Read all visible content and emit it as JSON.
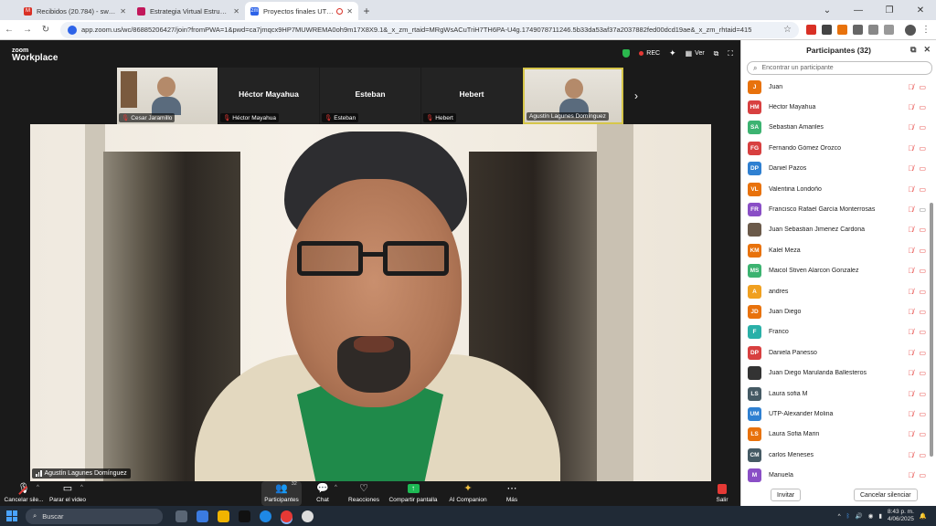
{
  "browser": {
    "tabs": [
      {
        "label": "Recibidos (20.784) - swokosky@",
        "favicon_color": "#d93025",
        "favicon_letter": "M",
        "active": false
      },
      {
        "label": "Estrategia Virtual Estructura de",
        "favicon_color": "#c2185b",
        "favicon_letter": "",
        "active": false
      },
      {
        "label": "Proyectos finales UTP-UV",
        "favicon_color": "#2d63e8",
        "favicon_letter": "zm",
        "active": true
      }
    ],
    "new_tab": "+",
    "url": "app.zoom.us/wc/86885206427/join?fromPWA=1&pwd=ca7jmqcx9HP7MUWREMA0oh9m17X8X9.1&_x_zm_rtaid=MRgWsACuTriH7TH6PA-U4g.1749078711246.5b33da53af37a2037882fed00dcd19ae&_x_zm_rhtaid=415"
  },
  "zoom": {
    "logo_top": "zoom",
    "logo_bottom": "Workplace",
    "rec_label": "REC",
    "view_label": "Ver",
    "gallery": [
      {
        "name": "Cesar Jaramillo",
        "has_video": true,
        "big": ""
      },
      {
        "name": "Héctor Mayahua",
        "has_video": false,
        "big": "Héctor Mayahua"
      },
      {
        "name": "Esteban",
        "has_video": false,
        "big": "Esteban"
      },
      {
        "name": "Hebert",
        "has_video": false,
        "big": "Hebert"
      },
      {
        "name": "Agustín Lagunes Domínguez",
        "has_video": true,
        "big": ""
      }
    ],
    "active_speaker": "Agustín Lagunes Domínguez",
    "toolbar": {
      "mic": "Cancelar sile...",
      "video": "Parar el video",
      "participants": "Participantes",
      "participants_count": "32",
      "chat": "Chat",
      "reactions": "Reacciones",
      "share": "Compartir pantalla",
      "companion": "AI Companion",
      "more": "Más",
      "leave": "Salir"
    }
  },
  "panel": {
    "title": "Participantes (32)",
    "search_placeholder": "Encontrar un participante",
    "invite": "Invitar",
    "mute_all": "Cancelar silenciar",
    "participants": [
      {
        "initials": "J",
        "name": "Juan",
        "color": "#e8720c",
        "video": false
      },
      {
        "initials": "HM",
        "name": "Héctor Mayahua",
        "color": "#d84040",
        "video": false
      },
      {
        "initials": "SA",
        "name": "Sebastian Amariles",
        "color": "#3cb371",
        "video": false
      },
      {
        "initials": "FG",
        "name": "Fernando Gómez Orozco",
        "color": "#d84040",
        "video": false
      },
      {
        "initials": "DP",
        "name": "Daniel Pazos",
        "color": "#2f80d1",
        "video": false
      },
      {
        "initials": "VL",
        "name": "Valentina Londoño",
        "color": "#e8720c",
        "video": false
      },
      {
        "initials": "FR",
        "name": "Francisco Rafael García Monterrosas",
        "color": "#8a4fc6",
        "video": true
      },
      {
        "initials": "",
        "name": "Juan Sebastian Jimenez Cardona",
        "color": "#6b5a4a",
        "video": false
      },
      {
        "initials": "KM",
        "name": "Kalel Meza",
        "color": "#e8720c",
        "video": false
      },
      {
        "initials": "MS",
        "name": "Maicol Stiven Alarcon Gonzalez",
        "color": "#3cb371",
        "video": false
      },
      {
        "initials": "A",
        "name": "andres",
        "color": "#f0a020",
        "video": false
      },
      {
        "initials": "JD",
        "name": "Juan Diego",
        "color": "#e8720c",
        "video": false
      },
      {
        "initials": "F",
        "name": "Franco",
        "color": "#2ab0a8",
        "video": false
      },
      {
        "initials": "DP",
        "name": "Daniela Panesso",
        "color": "#d84040",
        "video": false
      },
      {
        "initials": "",
        "name": "Juan Diego Marulanda Ballesteros",
        "color": "#333333",
        "video": false
      },
      {
        "initials": "LS",
        "name": "Laura sofia M",
        "color": "#455a64",
        "video": false
      },
      {
        "initials": "UM",
        "name": "UTP-Alexander Molina",
        "color": "#2f80d1",
        "video": false
      },
      {
        "initials": "LS",
        "name": "Laura Sofia Marin",
        "color": "#e8720c",
        "video": false
      },
      {
        "initials": "CM",
        "name": "carlos Meneses",
        "color": "#455a64",
        "video": false
      },
      {
        "initials": "M",
        "name": "Manuela",
        "color": "#8a4fc6",
        "video": false
      }
    ]
  },
  "taskbar": {
    "search": "Buscar",
    "time": "8:43 p. m.",
    "date": "4/06/2025"
  }
}
